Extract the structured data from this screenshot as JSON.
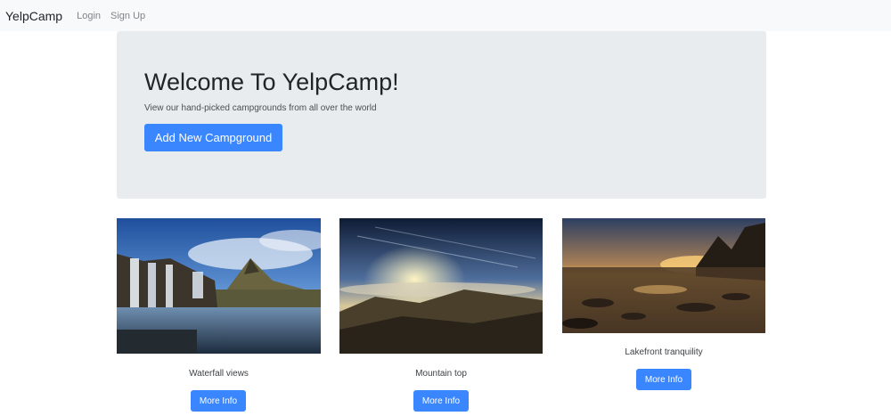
{
  "navbar": {
    "brand": "YelpCamp",
    "links": [
      "Login",
      "Sign Up"
    ]
  },
  "jumbotron": {
    "title": "Welcome To YelpCamp!",
    "subtitle": "View our hand-picked campgrounds from all over the world",
    "add_button": "Add New Campground"
  },
  "campgrounds": [
    {
      "name": "Waterfall views",
      "button": "More Info"
    },
    {
      "name": "Mountain top",
      "button": "More Info"
    },
    {
      "name": "Lakefront tranquility",
      "button": "More Info"
    }
  ],
  "colors": {
    "primary": "#3a86ff",
    "navbar_bg": "#f8f9fa",
    "jumbotron_bg": "#e9ecef"
  }
}
